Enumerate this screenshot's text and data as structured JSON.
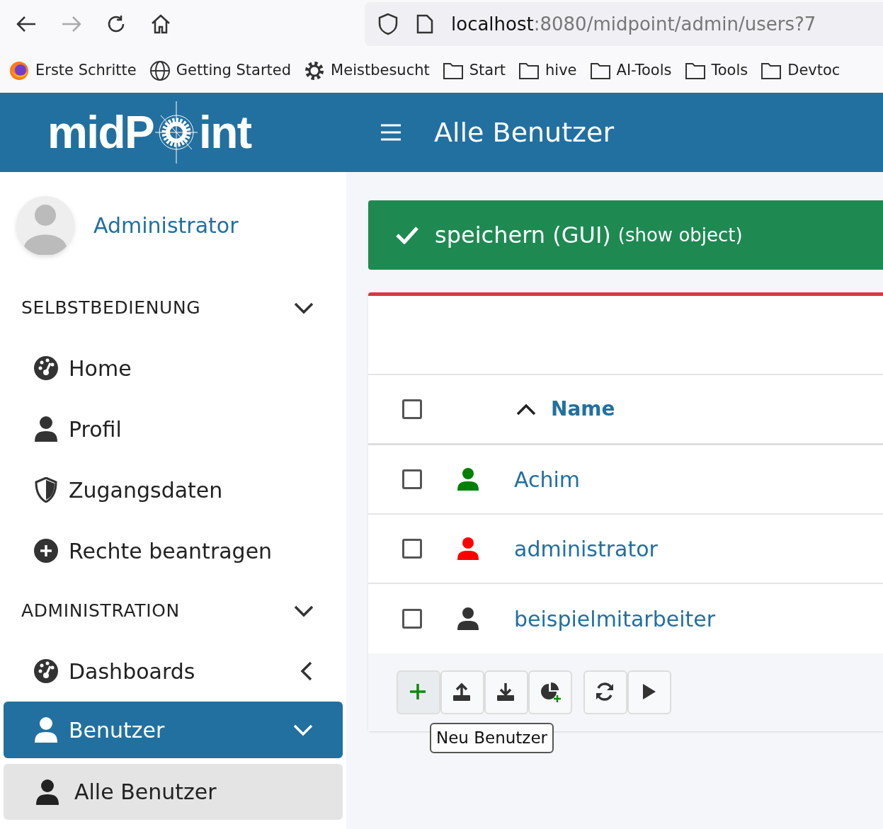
{
  "browser": {
    "url_host": "localhost",
    "url_rest": ":8080/midpoint/admin/users?7",
    "bookmarks": [
      {
        "label": "Erste Schritte",
        "kind": "firefox"
      },
      {
        "label": "Getting Started",
        "kind": "globe"
      },
      {
        "label": "Meistbesucht",
        "kind": "gear"
      },
      {
        "label": "Start",
        "kind": "folder"
      },
      {
        "label": "hive",
        "kind": "folder"
      },
      {
        "label": "AI-Tools",
        "kind": "folder"
      },
      {
        "label": "Tools",
        "kind": "folder"
      },
      {
        "label": "Devtoc",
        "kind": "folder"
      }
    ]
  },
  "header": {
    "logo_left": "midP",
    "logo_right": "int",
    "title": "Alle Benutzer"
  },
  "sidebar": {
    "user": "Administrator",
    "sections": [
      {
        "label": "SELBSTBEDIENUNG",
        "expanded": true,
        "items": [
          {
            "label": "Home",
            "kind": "dashboard",
            "selected": false
          },
          {
            "label": "Profil",
            "kind": "user",
            "selected": false
          },
          {
            "label": "Zugangsdaten",
            "kind": "shield",
            "selected": false
          },
          {
            "label": "Rechte beantragen",
            "kind": "plus",
            "selected": false
          }
        ]
      },
      {
        "label": "ADMINISTRATION",
        "expanded": true,
        "items": [
          {
            "label": "Dashboards",
            "kind": "dashboard",
            "selected": false,
            "expanded": false
          },
          {
            "label": "Benutzer",
            "kind": "user",
            "selected": true,
            "expanded": true,
            "children": [
              {
                "label": "Alle Benutzer",
                "kind": "user",
                "selected": true
              }
            ]
          }
        ]
      }
    ]
  },
  "alert": {
    "title": "speichern (GUI)",
    "link": "(show object)"
  },
  "table": {
    "column": "Name",
    "all_checked": false,
    "rows": [
      {
        "name": "Achim",
        "color": "#008000",
        "checked": false
      },
      {
        "name": "administrator",
        "color": "#ff0000",
        "checked": false
      },
      {
        "name": "beispielmitarbeiter",
        "color": "#333333",
        "checked": false
      }
    ]
  },
  "toolbar": {
    "buttons": [
      {
        "kind": "add"
      },
      {
        "kind": "import"
      },
      {
        "kind": "export"
      },
      {
        "kind": "report"
      },
      {
        "kind": "refresh"
      },
      {
        "kind": "play"
      }
    ],
    "tooltip": "Neu Benutzer"
  }
}
